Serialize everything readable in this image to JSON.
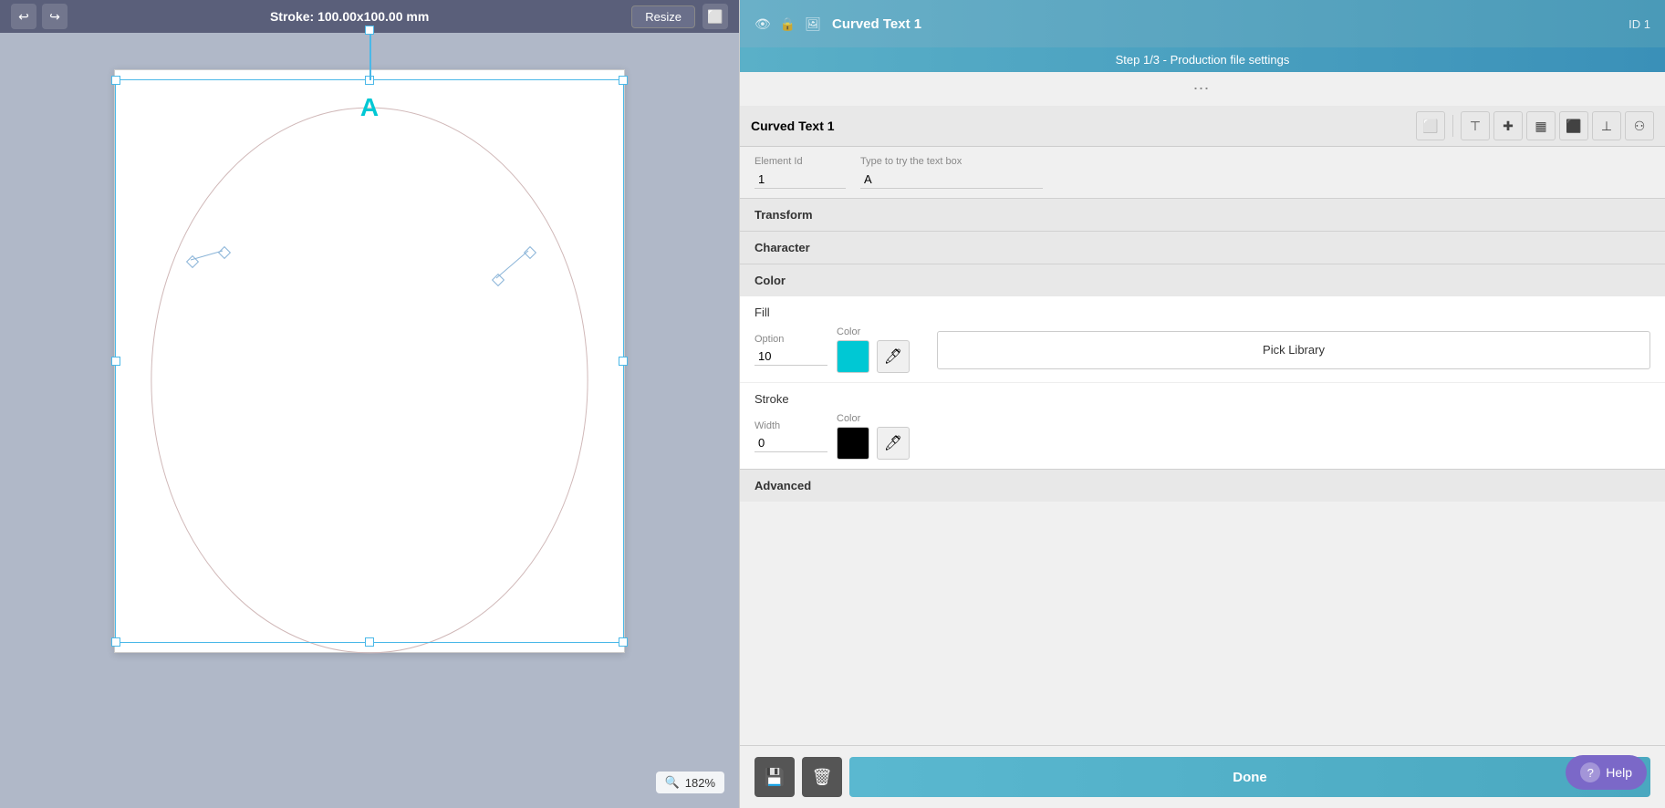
{
  "topbar": {
    "title": "Stroke: 100.00x100.00 mm",
    "resize_label": "Resize",
    "undo_icon": "↩",
    "redo_icon": "↪",
    "zoom_value": "182%"
  },
  "panel": {
    "header": {
      "title": "Step 1/3 - Production file settings",
      "element_name": "Curved Text 1",
      "id_label": "ID 1",
      "eye_icon": "👁",
      "lock_icon": "🔒",
      "image_icon": "🖼"
    },
    "dots": "⋮⋮⋮",
    "toolbar": {
      "label": "Curved Text 1",
      "icon1": "⬜",
      "icon2": "⬛",
      "icon3": "✚",
      "icon4": "📊",
      "icon5": "📋",
      "icon6": "⬛",
      "icon7": "⚇"
    },
    "fields": {
      "element_id_label": "Element Id",
      "element_id_value": "1",
      "text_label": "Type to try the text box",
      "text_value": "A"
    },
    "sections": {
      "transform": "Transform",
      "character": "Character",
      "color": "Color",
      "advanced": "Advanced"
    },
    "fill": {
      "label": "Fill",
      "option_label": "Option",
      "option_value": "10",
      "color_label": "Color",
      "color_hex": "#00c8d4",
      "pick_library_label": "Pick Library"
    },
    "stroke": {
      "label": "Stroke",
      "width_label": "Width",
      "width_value": "0",
      "color_label": "Color",
      "color_hex": "#000000"
    },
    "footer": {
      "save_icon": "💾",
      "delete_icon": "🗑",
      "done_label": "Done"
    },
    "help": {
      "label": "Help",
      "icon": "?"
    }
  },
  "canvas": {
    "letter": "A"
  }
}
